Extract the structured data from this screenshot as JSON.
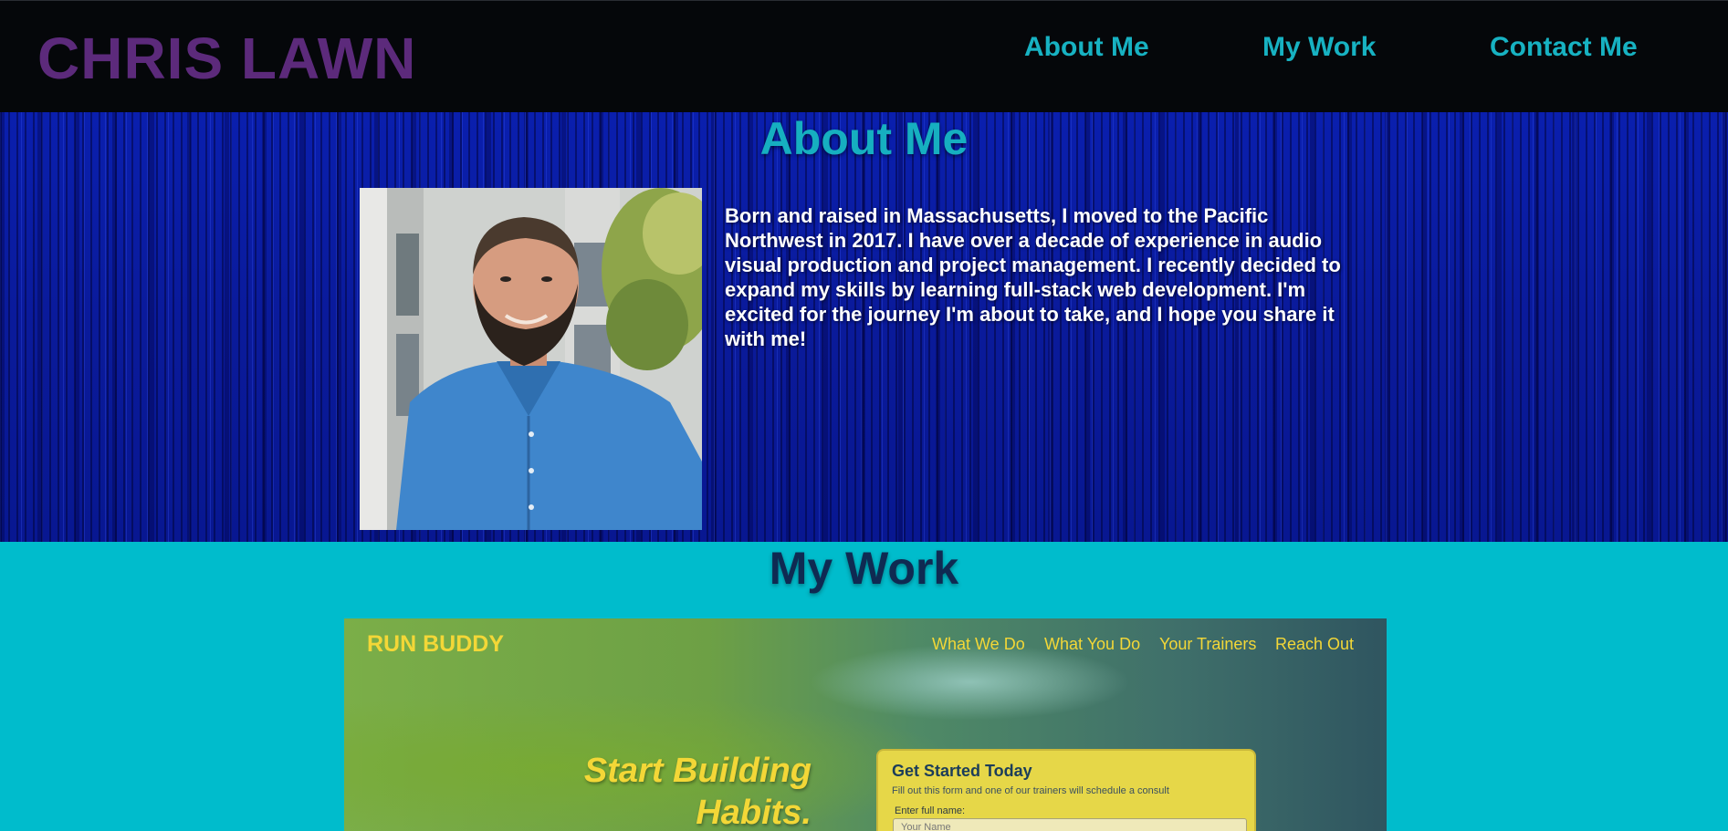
{
  "header": {
    "brand": "CHRIS LAWN",
    "nav": [
      {
        "label": "About Me"
      },
      {
        "label": "My Work"
      },
      {
        "label": "Contact Me"
      }
    ]
  },
  "about": {
    "title": "About Me",
    "text": "Born and raised in Massachusetts, I moved to the Pacific Northwest in 2017. I have over a decade of experience in audio visual production and project management. I recently decided to expand my skills by learning full-stack web development. I'm excited for the journey I'm about to take, and I hope you share it with me!"
  },
  "work": {
    "title": "My Work",
    "project": {
      "brand": "RUN BUDDY",
      "nav": [
        "What We Do",
        "What You Do",
        "Your Trainers",
        "Reach Out"
      ],
      "hero_line1": "Start Building",
      "hero_line2": "Habits.",
      "form": {
        "title": "Get Started Today",
        "subtitle": "Fill out this form and one of our trainers will schedule a consult",
        "label": "Enter full name:",
        "placeholder": "Your Name"
      }
    }
  },
  "colors": {
    "header_bg": "#05070a",
    "brand": "#5c2a7b",
    "nav_link": "#17b2c2",
    "about_bg": "#0a1fae",
    "work_bg": "#00bccc",
    "work_title": "#0f2a52",
    "runbuddy_yellow": "#f3d737"
  },
  "icons": {
    "portrait": "person-photo"
  }
}
